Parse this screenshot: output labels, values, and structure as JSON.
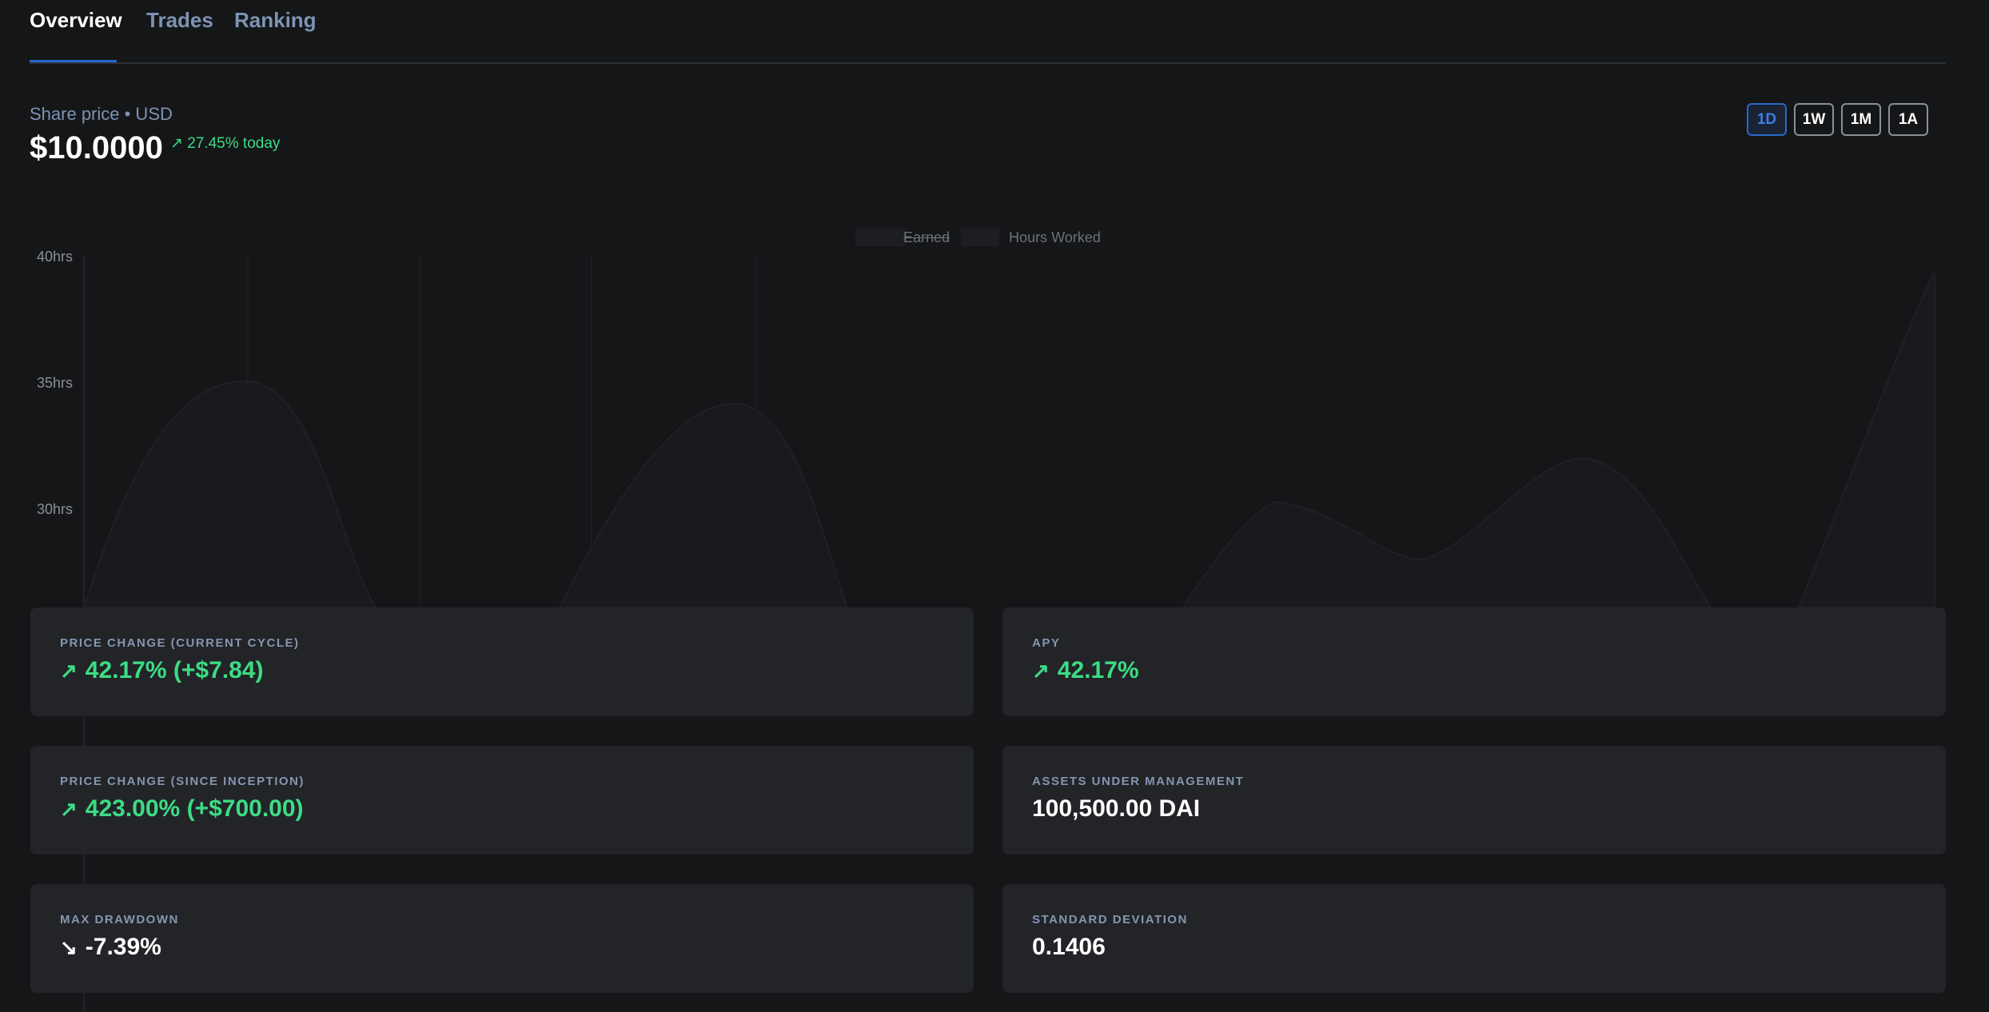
{
  "tabs": [
    {
      "label": "Overview",
      "active": true
    },
    {
      "label": "Trades",
      "active": false
    },
    {
      "label": "Ranking",
      "active": false
    }
  ],
  "price": {
    "label": "Share price • USD",
    "value": "$10.0000",
    "change_arrow": "↗",
    "change": "27.45% today"
  },
  "ranges": [
    {
      "label": "1D",
      "active": true
    },
    {
      "label": "1W",
      "active": false
    },
    {
      "label": "1M",
      "active": false
    },
    {
      "label": "1A",
      "active": false
    }
  ],
  "chart": {
    "legend": {
      "earned": "Earned",
      "hours": "Hours Worked"
    },
    "yticks": [
      "40hrs",
      "35hrs",
      "30hrs"
    ]
  },
  "chart_data": {
    "type": "area",
    "series": [
      {
        "name": "Earned",
        "visible": false
      },
      {
        "name": "Hours Worked",
        "values": [
          35,
          34,
          30,
          32,
          40
        ]
      }
    ],
    "ylabels": [
      "40hrs",
      "35hrs",
      "30hrs"
    ],
    "grid": true,
    "legend_placement": "top-center"
  },
  "cards": [
    {
      "label": "PRICE CHANGE (CURRENT CYCLE)",
      "arrow": "↗",
      "value": "42.17% (+$7.84)",
      "color": "green"
    },
    {
      "label": "APY",
      "arrow": "↗",
      "value": "42.17%",
      "color": "green"
    },
    {
      "label": "PRICE CHANGE (SINCE INCEPTION)",
      "arrow": "↗",
      "value": "423.00% (+$700.00)",
      "color": "green"
    },
    {
      "label": "ASSETS UNDER MANAGEMENT",
      "arrow": "",
      "value": "100,500.00 DAI",
      "color": "white"
    },
    {
      "label": "MAX DRAWDOWN",
      "arrow": "↘",
      "value": "-7.39%",
      "color": "white"
    },
    {
      "label": "STANDARD DEVIATION",
      "arrow": "",
      "value": "0.1406",
      "color": "white"
    }
  ],
  "colors": {
    "accent": "#2a66c9",
    "positive": "#3ddc84",
    "card_bg": "#222428",
    "page_bg": "#151618"
  }
}
